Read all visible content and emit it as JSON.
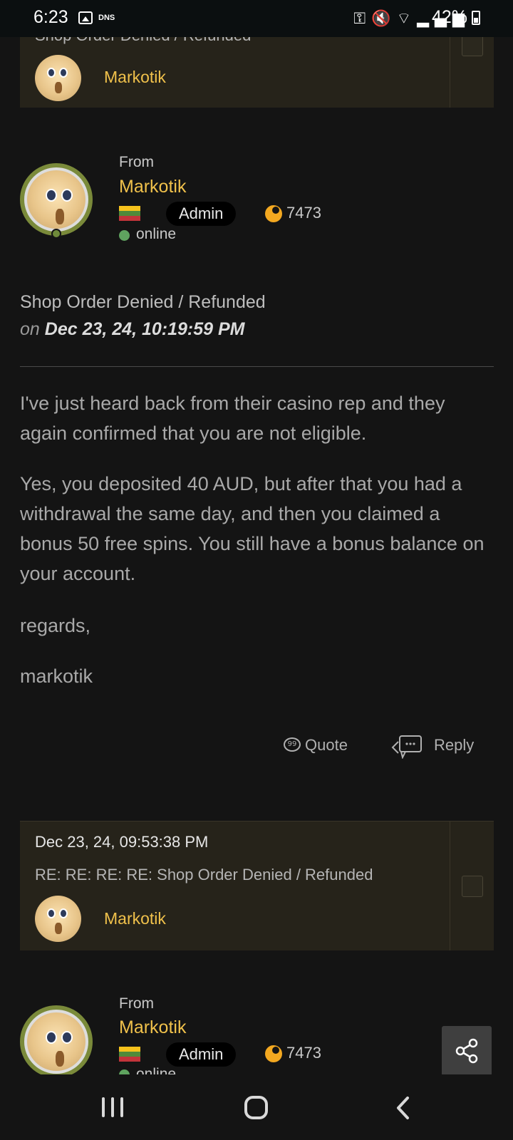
{
  "status_bar": {
    "time": "6:23",
    "dns_label": "DNS",
    "battery": "42%",
    "icons": [
      "gallery-icon",
      "key-icon",
      "mute-icon",
      "wifi-icon",
      "volte-icon",
      "signal-icon",
      "battery-icon"
    ]
  },
  "top_card": {
    "subject": "Shop Order Denied / Refunded",
    "author": "Markotik"
  },
  "post": {
    "from_label": "From",
    "author": "Markotik",
    "role": "Admin",
    "points": "7473",
    "status": "online",
    "subject": "Shop Order Denied / Refunded",
    "date_prefix": "on",
    "date": "Dec 23, 24, 10:19:59 PM",
    "paragraphs": [
      "I've just heard back from their casino rep and they again confirmed that you are not eligible.",
      "Yes, you deposited 40 AUD, but after that you had a withdrawal the same day, and then you claimed a bonus 50 free spins. You still have a bonus balance on your account.",
      "regards,",
      "markotik"
    ],
    "quote_label": "Quote",
    "reply_label": "Reply"
  },
  "second_card": {
    "date": "Dec 23, 24, 09:53:38 PM",
    "subject": "RE: RE: RE: RE: Shop Order Denied / Refunded",
    "author": "Markotik"
  },
  "second_post": {
    "from_label": "From",
    "author": "Markotik",
    "role": "Admin",
    "points": "7473",
    "status": "online"
  },
  "colors": {
    "accent": "#f0c14b",
    "card_bg": "#26231a",
    "page_bg": "#141414",
    "online": "#5fa35f"
  }
}
